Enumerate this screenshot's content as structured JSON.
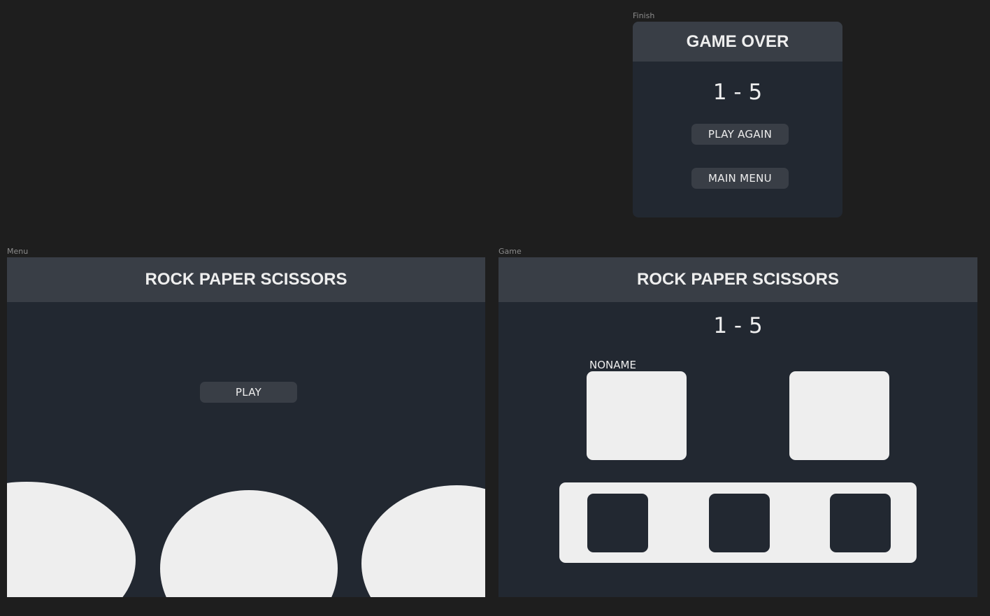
{
  "finish": {
    "frame_label": "Finish",
    "title": "GAME OVER",
    "score": "1 - 5",
    "play_again_label": "PLAY AGAIN",
    "main_menu_label": "MAIN MENU"
  },
  "menu": {
    "frame_label": "Menu",
    "title": "ROCK PAPER SCISSORS",
    "play_label": "PLAY"
  },
  "game": {
    "frame_label": "Game",
    "title": "ROCK PAPER SCISSORS",
    "score": "1 - 5",
    "player_name": "NONAME"
  },
  "colors": {
    "canvas": "#1e1e1e",
    "frame_bg": "#222831",
    "header_bg": "#393e46",
    "light": "#eeeeee"
  }
}
